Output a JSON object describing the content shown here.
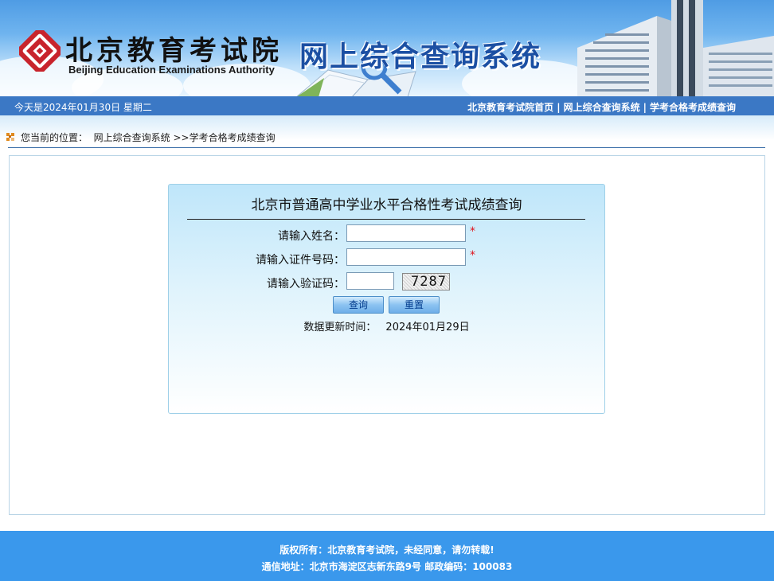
{
  "header": {
    "logo_cn": "北京教育考试院",
    "logo_en": "Beijing Education Examinations Authority",
    "system_title": "网上综合查询系统"
  },
  "topbar": {
    "date_text": "今天是2024年01月30日  星期二",
    "links": [
      "北京教育考试院首页",
      "网上综合查询系统",
      "学考合格考成绩查询"
    ],
    "separator": "|"
  },
  "breadcrumb": {
    "prefix": "您当前的位置：",
    "items": [
      "网上综合查询系统",
      ">>学考合格考成绩查询"
    ]
  },
  "form": {
    "title": "北京市普通高中学业水平合格性考试成绩查询",
    "name_label": "请输入姓名：",
    "name_value": "",
    "id_label": "请输入证件号码：",
    "id_value": "",
    "captcha_label": "请输入验证码：",
    "captcha_value": "",
    "captcha_text": "7287",
    "required_mark": "*",
    "query_button": "查询",
    "reset_button": "重置",
    "update_label": "数据更新时间：",
    "update_value": "2024年01月29日"
  },
  "footer": {
    "line1": "版权所有：北京教育考试院，未经同意，请勿转载!",
    "line2": "通信地址：北京市海淀区志新东路9号 邮政编码：100083"
  },
  "colors": {
    "topbar": "#3b78c5",
    "title_blue": "#1b4fa3",
    "footer": "#3a98ec",
    "required": "#e0141e",
    "logo_red": "#c8232c"
  }
}
